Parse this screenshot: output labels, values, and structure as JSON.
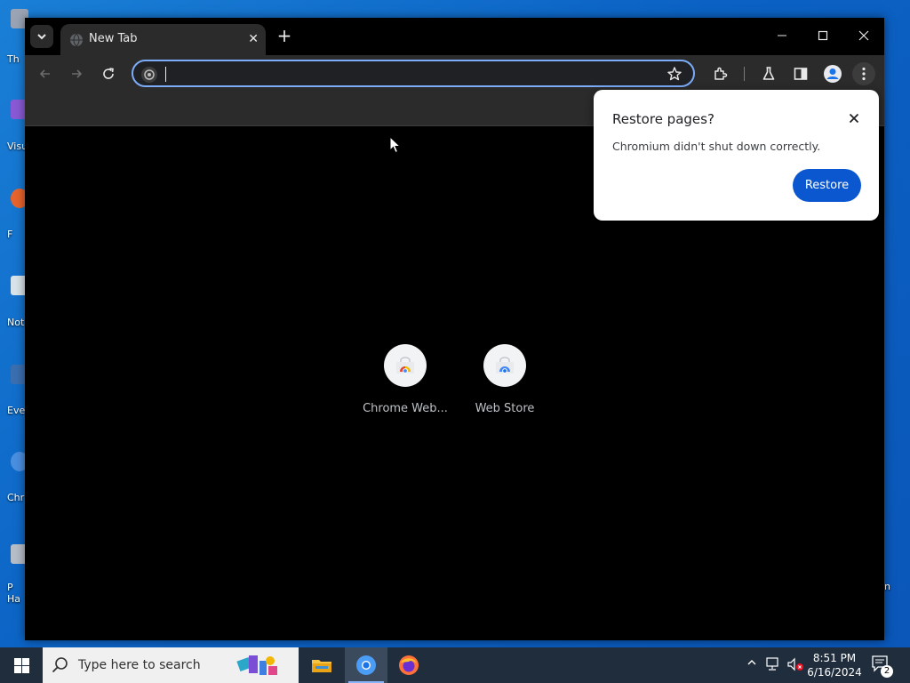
{
  "desktop": {
    "icon_labels": [
      "Th",
      "Visu",
      "F",
      "Not",
      "Eve",
      "Chr",
      "P Ha"
    ],
    "right_label": "in"
  },
  "browser": {
    "tab": {
      "title": "New Tab",
      "close_symbol": "✕"
    },
    "new_tab_symbol": "+",
    "omnibox": {
      "value": "",
      "placeholder": ""
    },
    "shortcuts": [
      {
        "label": "Chrome Web..."
      },
      {
        "label": "Web Store"
      }
    ],
    "accent": "#0b57d0"
  },
  "restore_dialog": {
    "title": "Restore pages?",
    "message": "Chromium didn't shut down correctly.",
    "restore_label": "Restore"
  },
  "taskbar": {
    "search_placeholder": "Type here to search",
    "time": "8:51 PM",
    "date": "6/16/2024",
    "notification_count": "2"
  }
}
